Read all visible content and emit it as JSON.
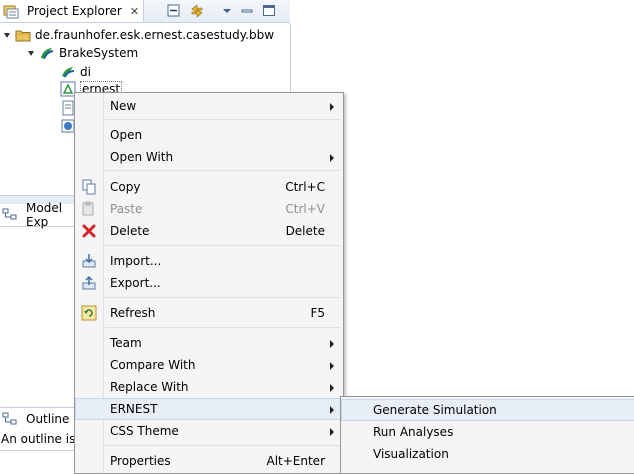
{
  "project_explorer": {
    "tab_label": "Project Explorer",
    "tree": {
      "project": "de.fraunhofer.esk.ernest.casestudy.bbw",
      "folder": "BrakeSystem",
      "item_di": "di",
      "item_ernest": "ernest"
    }
  },
  "model_explorer": {
    "tab_label": "Model Exp"
  },
  "outline": {
    "tab_label": "Outline",
    "message": "An outline is n"
  },
  "context_menu": {
    "items": [
      {
        "label": "New"
      },
      {
        "label": "Open"
      },
      {
        "label": "Open With"
      },
      {
        "label": "Copy",
        "shortcut": "Ctrl+C"
      },
      {
        "label": "Paste",
        "shortcut": "Ctrl+V"
      },
      {
        "label": "Delete",
        "shortcut": "Delete"
      },
      {
        "label": "Import..."
      },
      {
        "label": "Export..."
      },
      {
        "label": "Refresh",
        "shortcut": "F5"
      },
      {
        "label": "Team"
      },
      {
        "label": "Compare With"
      },
      {
        "label": "Replace With"
      },
      {
        "label": "ERNEST"
      },
      {
        "label": "CSS Theme"
      },
      {
        "label": "Properties",
        "shortcut": "Alt+Enter"
      }
    ]
  },
  "ernest_submenu": {
    "items": [
      {
        "label": "Generate Simulation"
      },
      {
        "label": "Run Analyses"
      },
      {
        "label": "Visualization"
      }
    ]
  },
  "colors": {
    "menu_bg": "#f5f5f5",
    "highlight_bg": "#e8eef6",
    "view_border": "#c5d0de"
  }
}
